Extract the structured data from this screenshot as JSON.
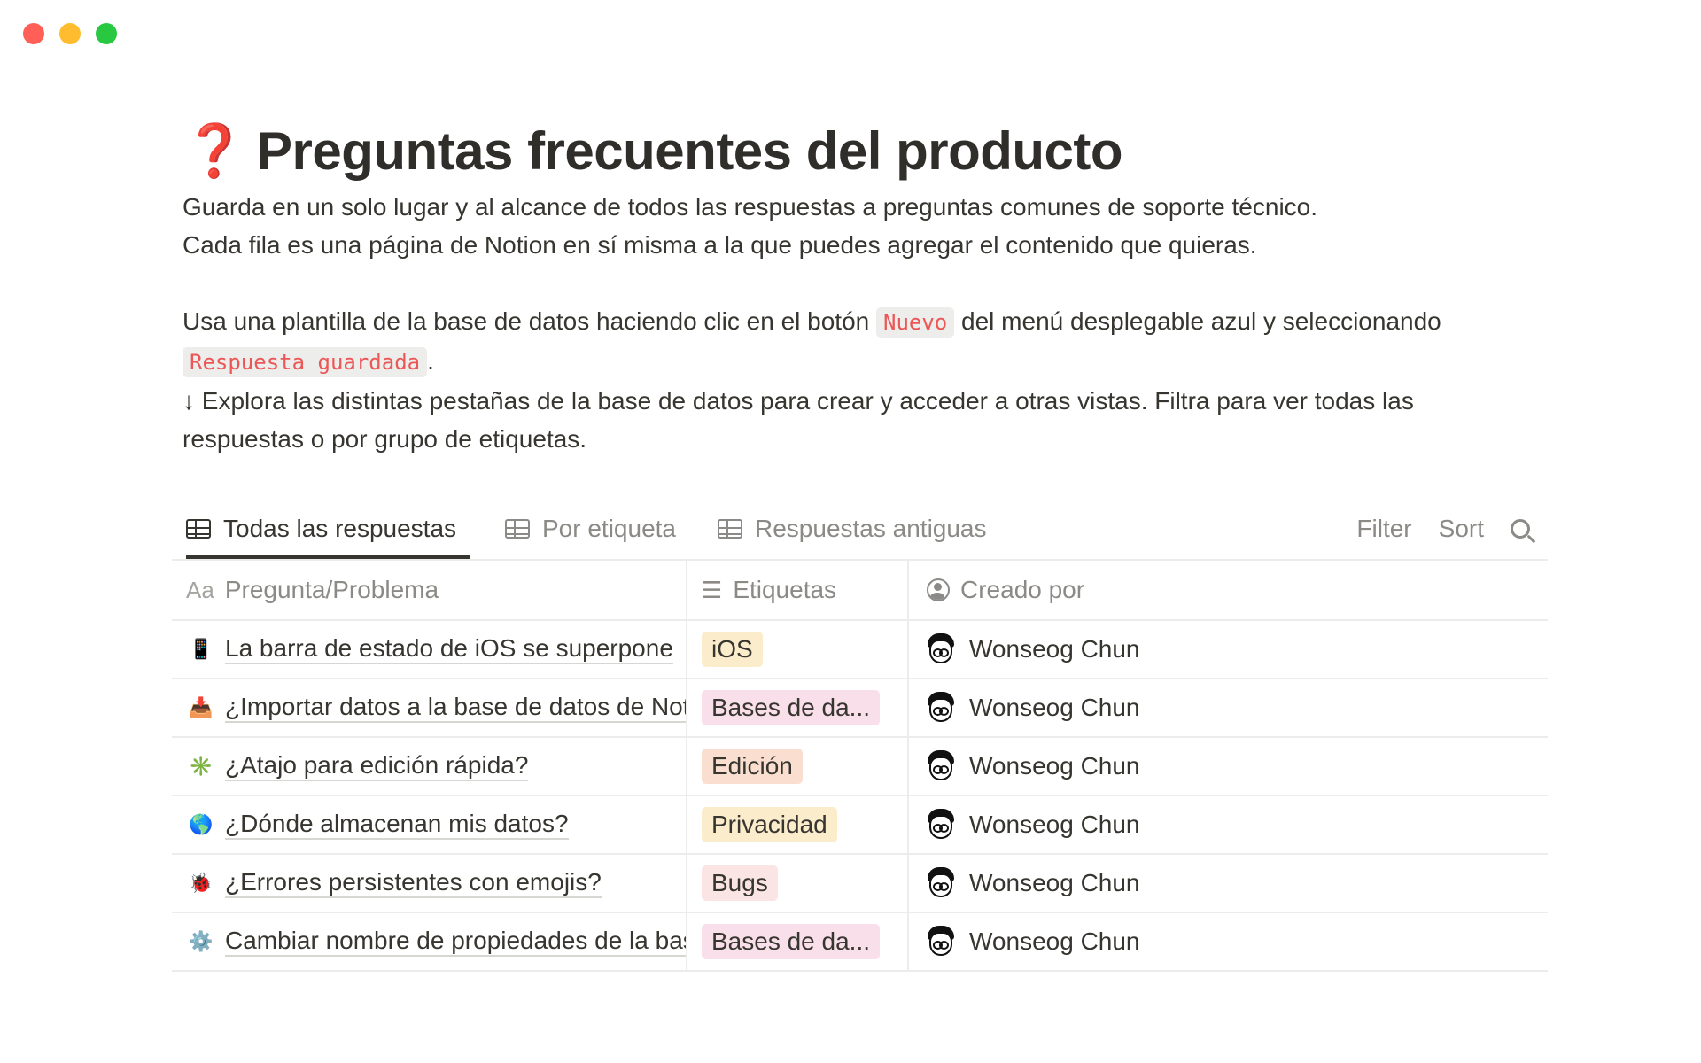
{
  "window": {
    "controls": [
      "close",
      "minimize",
      "zoom"
    ]
  },
  "page": {
    "icon": "❓",
    "title": "Preguntas frecuentes del producto",
    "desc_line1": "Guarda en un solo lugar y al alcance de todos las respuestas a preguntas comunes de soporte técnico.",
    "desc_line2": "Cada fila es una página de Notion en sí misma a la que puedes agregar el contenido que quieras.",
    "desc_line3_a": "Usa una plantilla de la base de datos haciendo clic en el botón",
    "desc_line3_code": "Nuevo",
    "desc_line3_b": "del menú desplegable azul y seleccionando",
    "desc_line4_code": "Respuesta guardada",
    "desc_line4_end": ".",
    "desc_line5": "↓ Explora las distintas pestañas de la base de datos para crear y acceder a otras vistas. Filtra para ver todas las",
    "desc_line6": "respuestas o por grupo de etiquetas."
  },
  "tabs": [
    {
      "label": "Todas las respuestas",
      "active": true
    },
    {
      "label": "Por etiqueta",
      "active": false
    },
    {
      "label": "Respuestas antiguas",
      "active": false
    }
  ],
  "toolbar": {
    "filter": "Filter",
    "sort": "Sort",
    "search_icon": "search-icon"
  },
  "table": {
    "columns": [
      {
        "prefix": "Aa",
        "label": "Pregunta/Problema"
      },
      {
        "icon": "list-icon",
        "label": "Etiquetas"
      },
      {
        "icon": "person-icon",
        "label": "Creado por"
      }
    ],
    "rows": [
      {
        "icon": "📱",
        "title": "La barra de estado de iOS se superpone",
        "tag": "iOS",
        "tag_color": "#fbeccb",
        "author": "Wonseog Chun"
      },
      {
        "icon": "📥",
        "title": "¿Importar datos a la base de datos de Notion?",
        "tag": "Bases de da...",
        "tag_color": "#f9dfea",
        "author": "Wonseog Chun"
      },
      {
        "icon": "✳️",
        "title": "¿Atajo para edición rápida?",
        "tag": "Edición",
        "tag_color": "#fadfd1",
        "author": "Wonseog Chun"
      },
      {
        "icon": "🌎",
        "title": "¿Dónde almacenan mis datos?",
        "tag": "Privacidad",
        "tag_color": "#fbeccb",
        "author": "Wonseog Chun"
      },
      {
        "icon": "🐞",
        "title": "¿Errores persistentes con emojis?",
        "tag": "Bugs",
        "tag_color": "#fbe4e4",
        "author": "Wonseog Chun"
      },
      {
        "icon": "⚙️",
        "title": "Cambiar nombre de propiedades de la base",
        "tag": "Bases de da...",
        "tag_color": "#f9dfea",
        "author": "Wonseog Chun"
      }
    ]
  }
}
